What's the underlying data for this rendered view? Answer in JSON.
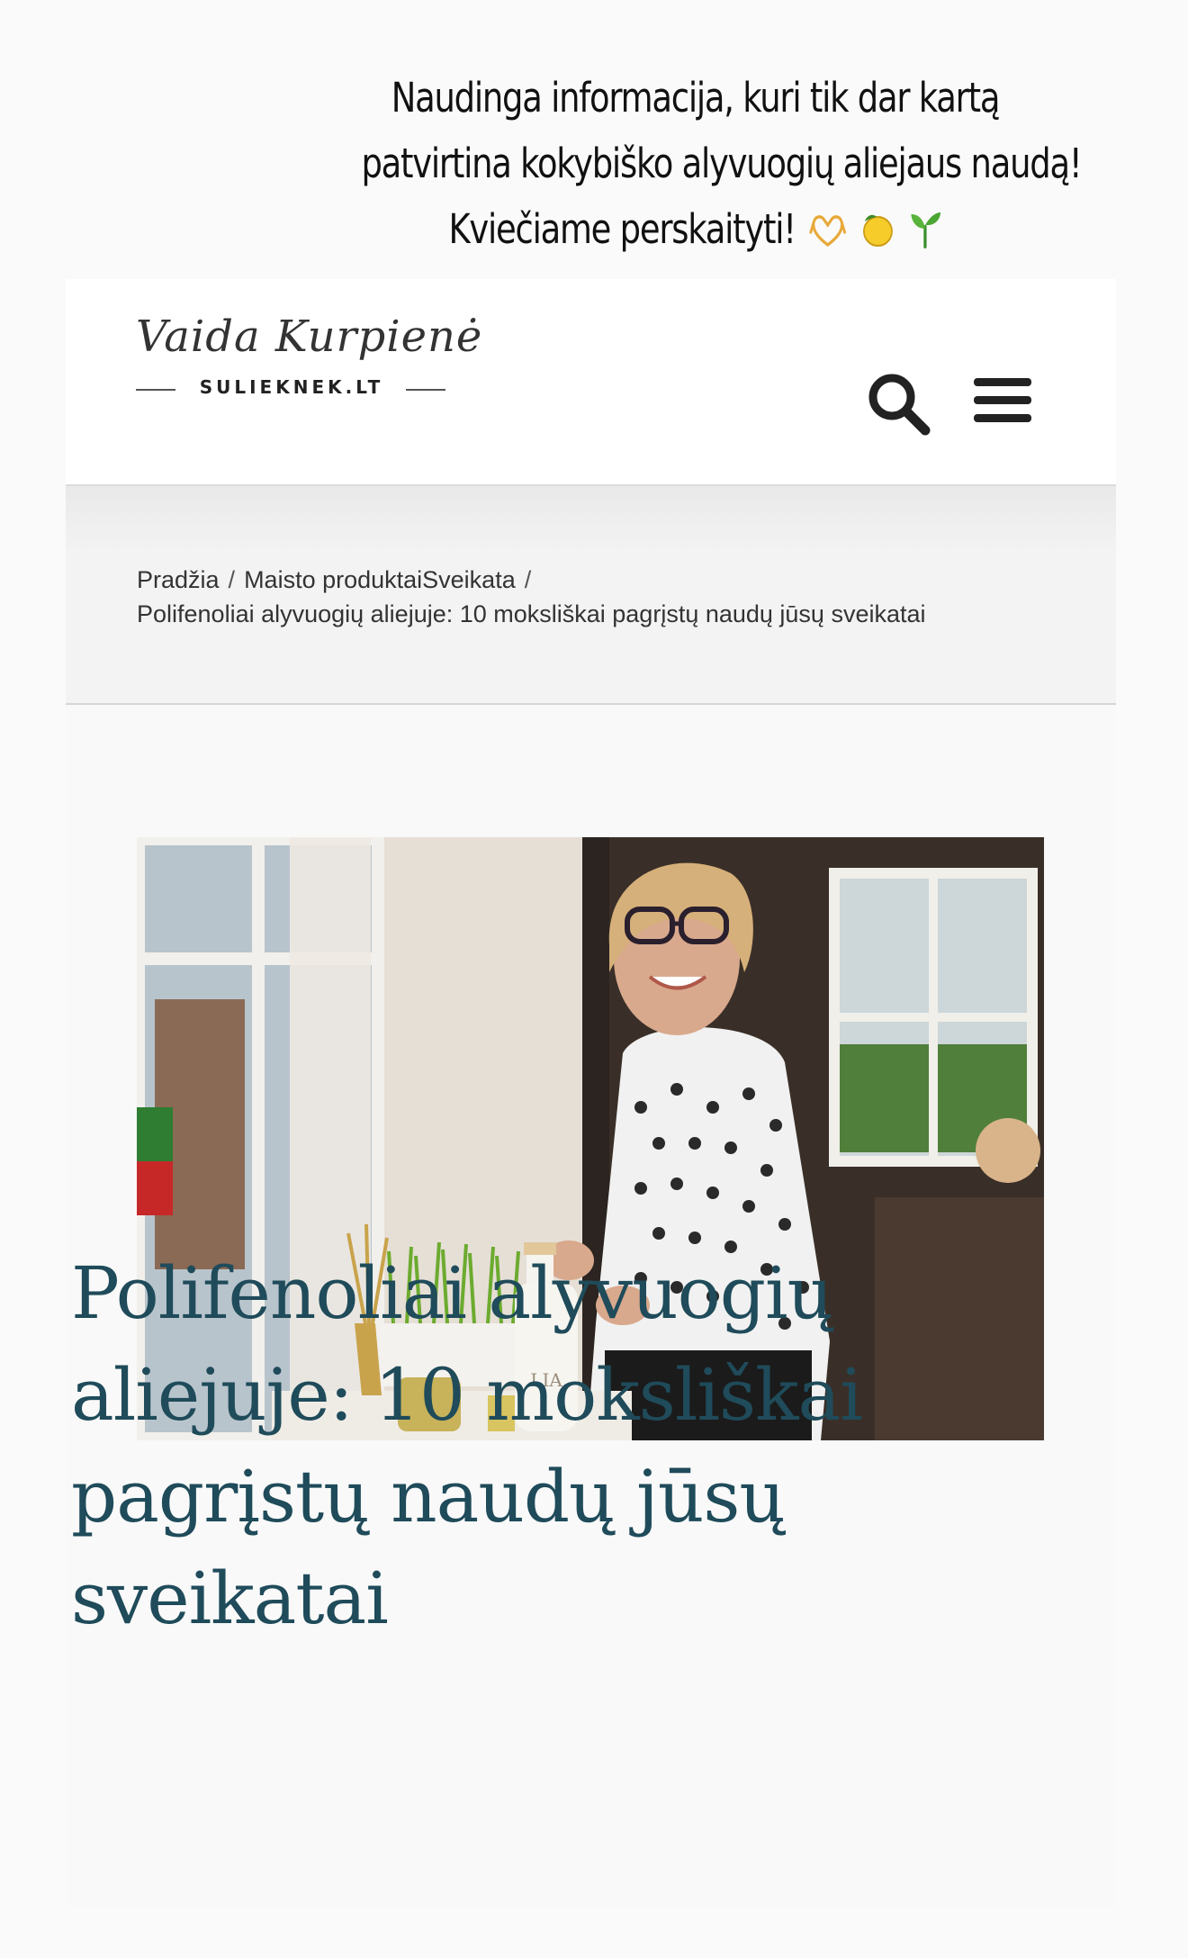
{
  "story": {
    "caption_lines": [
      "Naudinga informacija, kuri tik dar kartą",
      "patvirtina kokybiško alyvuogių aliejaus naudą!",
      "Kviečiame perskaityti!"
    ],
    "emojis": [
      "heart-hands",
      "lemon",
      "seedling"
    ]
  },
  "header": {
    "logo_script": "Vaida Kurpienė",
    "logo_domain": "SULIEKNEK.LT",
    "search_icon": "search-icon",
    "menu_icon": "hamburger-menu-icon"
  },
  "breadcrumb": {
    "home": "Pradžia",
    "category": "Maisto produktaiSveikata",
    "separator": "/",
    "current": "Polifenoliai alyvuogių aliejuje: 10 moksliškai pagrįstų naudų jūsų sveikatai"
  },
  "hero_image": {
    "bottle_label": "LIA"
  },
  "article": {
    "title": "Polifenoliai alyvuogių aliejuje: 10 moksliškai pagrįstų naudų jūsų sveikatai"
  },
  "colors": {
    "title": "#1f4b5a",
    "page_bg": "#fafafa",
    "header_bg": "#ffffff",
    "breadcrumb_bg": "#f3f3f3"
  }
}
